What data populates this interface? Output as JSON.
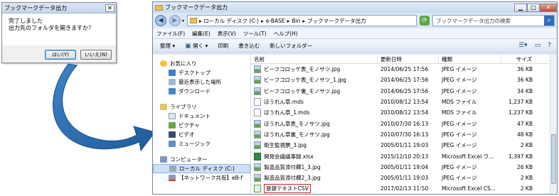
{
  "dialog": {
    "title": "ブックマークデータ出力",
    "close": "✕",
    "message_line1": "完了しました",
    "message_line2": "出力先のフォルダを開きますか？",
    "yes": "はい(Y)",
    "no": "いいえ(N)"
  },
  "explorer": {
    "title": "ブックマークデータ出力",
    "window_buttons": {
      "minimize": "▁",
      "maximize": "□",
      "close": "✕"
    },
    "address": {
      "arrow": "▸",
      "parts": [
        "ローカル ディスク (C:)",
        "e-BASE",
        "Bin",
        "ブックマークデータ出力"
      ],
      "seps": [
        "▸",
        "▸",
        "▸"
      ]
    },
    "search_placeholder": "ブックマークデータ出力の検索",
    "menu": [
      "ファイル(F)",
      "編集(E)",
      "表示(V)",
      "ツール(T)",
      "ヘルプ(H)"
    ],
    "toolbar": {
      "organize": "整理 ▾",
      "open": "開く ▾",
      "print": "印刷",
      "burn": "書き込む",
      "new_folder": "新しいフォルダー"
    },
    "sidebar": {
      "favorites": "お気に入り",
      "desktop": "デスクトップ",
      "recent": "最近表示した場所",
      "downloads": "ダウンロード",
      "libraries": "ライブラリ",
      "documents": "ドキュメント",
      "pictures": "ピクチャ",
      "videos": "ビデオ",
      "music": "ミュージック",
      "computer": "コンピューター",
      "local_disk": "ローカル ディスク (C:)",
      "network": "【ネットワーク共有】eB-f"
    },
    "columns": {
      "name": "名前",
      "date": "更新日時",
      "type": "種類",
      "size": "サイズ"
    },
    "files": [
      {
        "name": "ビーフコロッケ表_モノサツ.jpg",
        "date": "2014/06/25 17:56",
        "type": "JPEG イメージ",
        "size": "36 KB",
        "kind": "jpg"
      },
      {
        "name": "ビーフコロッケ表_モノサツ_1.jpg",
        "date": "2014/06/25 17:56",
        "type": "JPEG イメージ",
        "size": "36 KB",
        "kind": "jpg"
      },
      {
        "name": "ビーフコロッケ裏_モノサツ.jpg",
        "date": "2014/06/25 17:56",
        "type": "JPEG イメージ",
        "size": "34 KB",
        "kind": "jpg"
      },
      {
        "name": "ほうれん草.mds",
        "date": "2010/08/12 13:54",
        "type": "MDS ファイル",
        "size": "1,237 KB",
        "kind": "mds"
      },
      {
        "name": "ほうれん草_1.mds",
        "date": "2010/08/12 13:54",
        "type": "MDS ファイル",
        "size": "1,237 KB",
        "kind": "mds"
      },
      {
        "name": "ほうれん草表_モノサツ.jpg",
        "date": "2010/07/30 16:13",
        "type": "JPEG イメージ",
        "size": "47 KB",
        "kind": "jpg"
      },
      {
        "name": "ほうれん草裏_モノサツ.jpg",
        "date": "2010/07/30 16:13",
        "type": "JPEG イメージ",
        "size": "48 KB",
        "kind": "jpg"
      },
      {
        "name": "衛生監視票_3.jpg",
        "date": "2005/01/11 19:03",
        "type": "JPEG イメージ",
        "size": "2 KB",
        "kind": "jpg"
      },
      {
        "name": "開発会議議事録.xlsx",
        "date": "2015/12/10 20:13",
        "type": "Microsoft Excel ワ...",
        "size": "1,397 KB",
        "kind": "xls"
      },
      {
        "name": "製造品質添付欄1_3.jpg",
        "date": "2005/01/11 19:04",
        "type": "JPEG イメージ",
        "size": "26 KB",
        "kind": "jpg"
      },
      {
        "name": "製造品質添付欄2_3.jpg",
        "date": "2005/01/11 19:03",
        "type": "JPEG イメージ",
        "size": "2 KB",
        "kind": "jpg"
      },
      {
        "name": "登録テキストCSV",
        "date": "2017/02/13 11:50",
        "type": "Microsoft Excel CS...",
        "size": "2 KB",
        "kind": "csv",
        "highlight": true
      }
    ]
  },
  "colors": {
    "highlight_border": "#d21f1f",
    "arrow": "#2e6fb2"
  }
}
